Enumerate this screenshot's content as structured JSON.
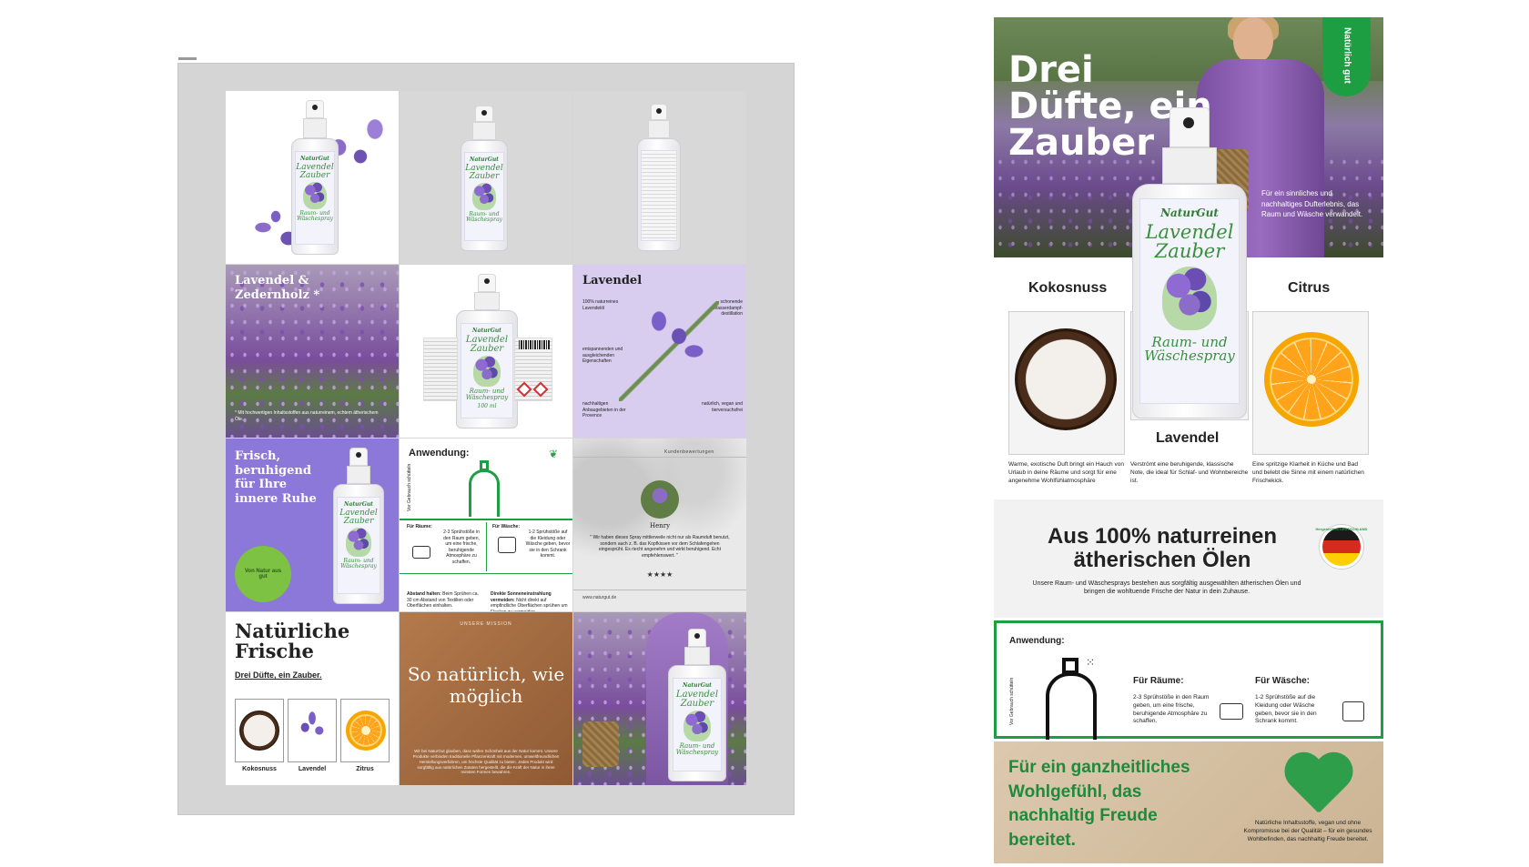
{
  "board": {
    "bottle_brand": "NaturGut",
    "bottle_name": "Lavendel Zauber",
    "bottle_sub": "Raum- und Wäschespray",
    "bottle_volume": "100 ml",
    "tile_lz": {
      "title": "Lavendel & Zedernholz *",
      "note": "* Mit hochwertigen Inhaltsstoffen aus naturreinem, echtem ätherischem Öle."
    },
    "tile_lavendel": {
      "title": "Lavendel",
      "f1": "100% naturreines Lavendelöl",
      "f2": "schonende Wasserdampf-destillation",
      "f3": "entspannenden und ausgleichenden Eigenschaften",
      "f4": "nachhaltigen Anbaugebieten in der Provence",
      "f5": "natürlich, vegan und tierversuchsfrei"
    },
    "tile_frisch": {
      "title": "Frisch, beruhigend für Ihre innere Ruhe",
      "badge": "Von Natur aus gut"
    },
    "tile_anwendung": {
      "title": "Anwendung:",
      "side": "Vor Gebrauch schütteln",
      "rooms_h": "Für Räume:",
      "rooms_t": "2-3 Sprühstöße in den Raum geben, um eine frische, beruhigende Atmosphäre zu schaffen.",
      "wash_h": "Für Wäsche:",
      "wash_t": "1-2 Sprühstöße auf die Kleidung oder Wäsche geben, bevor sie in den Schrank kommt.",
      "f1_h": "Abstand halten:",
      "f1_t": "Beim Sprühen ca. 30 cm Abstand von Textilien oder Oberflächen einhalten.",
      "f2_h": "Direkte Sonneneinstrahlung vermeiden:",
      "f2_t": "Nicht direkt auf empfindliche Oberflächen sprühen um Flecken zu vermeiden."
    },
    "tile_review": {
      "header": "Kundenbewertungen",
      "name": "Henry",
      "quote": "\" Wir haben dieses Spray mittlerweile nicht nur als Raumduft benutzt, sondern auch z. B. das Kopfkissen vor dem Schlafengehen eingesprüht. Es riecht angenehm und wirkt beruhigend. Echt empfehlenswert. \"",
      "stars": "★★★★",
      "url": "www.naturgut.de"
    },
    "tile_natuerlich": {
      "title": "Natürliche Frische",
      "sub": "Drei Düfte, ein Zauber.",
      "l1": "Kokosnuss",
      "l2": "Lavendel",
      "l3": "Zitrus"
    },
    "tile_mission": {
      "label": "UNSERE MISSION",
      "title": "So natürlich, wie möglich",
      "text": "Wir bei NaturGut glauben, dass wahre Schönheit aus der Natur kommt. Unsere Produkte verbinden traditionelle Pflanzenkraft mit modernen, umweltfreundlichen Herstellungsverfahren, um höchste Qualität zu bieten. Jedes Produkt wird sorgfältig aus natürlichen Zutaten hergestellt, die die Kraft der Natur in ihren reinsten Formen bewahren."
    }
  },
  "right": {
    "hero_title": "Drei Düfte, ein Zauber",
    "hero_tag": "Natürlich gut",
    "hero_sub": "Für ein sinnliches und nachhaltiges Dufterlebnis, das Raum und Wäsche verwandelt.",
    "scents": {
      "kokos": "Kokosnuss",
      "citrus": "Citrus",
      "lavendel": "Lavendel",
      "kokos_t": "Warme, exotische Duft bringt ein Hauch von Urlaub in deine Räume und sorgt für eine angenehme Wohlfühlatmosphäre",
      "lav_t": "Verströmt eine beruhigende, klassische Note, die ideal für Schlaf- und Wohnbereiche ist.",
      "citrus_t": "Eine spritzige Klarheit in Küche und Bad und belebt die Sinne mit einem natürlichen Frischekick."
    },
    "oils": {
      "title": "Aus 100% naturreinen ätherischen Ölen",
      "text": "Unsere Raum- und Wäschesprays bestehen aus sorgfältig ausgewählten ätherischen Ölen und bringen die wohltuende Frische der Natur in dein Zuhause.",
      "badge": "Hergestellt in DEUTSCHLAND"
    },
    "usage": {
      "title": "Anwendung:",
      "side": "Vor Gebrauch schütteln",
      "rooms_h": "Für Räume:",
      "rooms_t": "2-3 Sprühstöße in den Raum geben, um eine frische, beruhigende Atmosphäre zu schaffen.",
      "wash_h": "Für Wäsche:",
      "wash_t": "1-2 Sprühstöße auf die Kleidung oder Wäsche geben, bevor sie in den Schrank kommt."
    },
    "holistic": {
      "title": "Für ein ganzheitliches Wohlgefühl, das nachhaltig Freude bereitet.",
      "text": "Natürliche Inhaltsstoffe, vegan und ohne Kompromisse bei der Qualität – für ein gesundes Wohlbefinden, das nachhaltig Freude bereitet."
    }
  },
  "colors": {
    "accent_green": "#1e9e43",
    "lavender": "#7b5fc9",
    "board_bg": "#d5d5d5"
  }
}
